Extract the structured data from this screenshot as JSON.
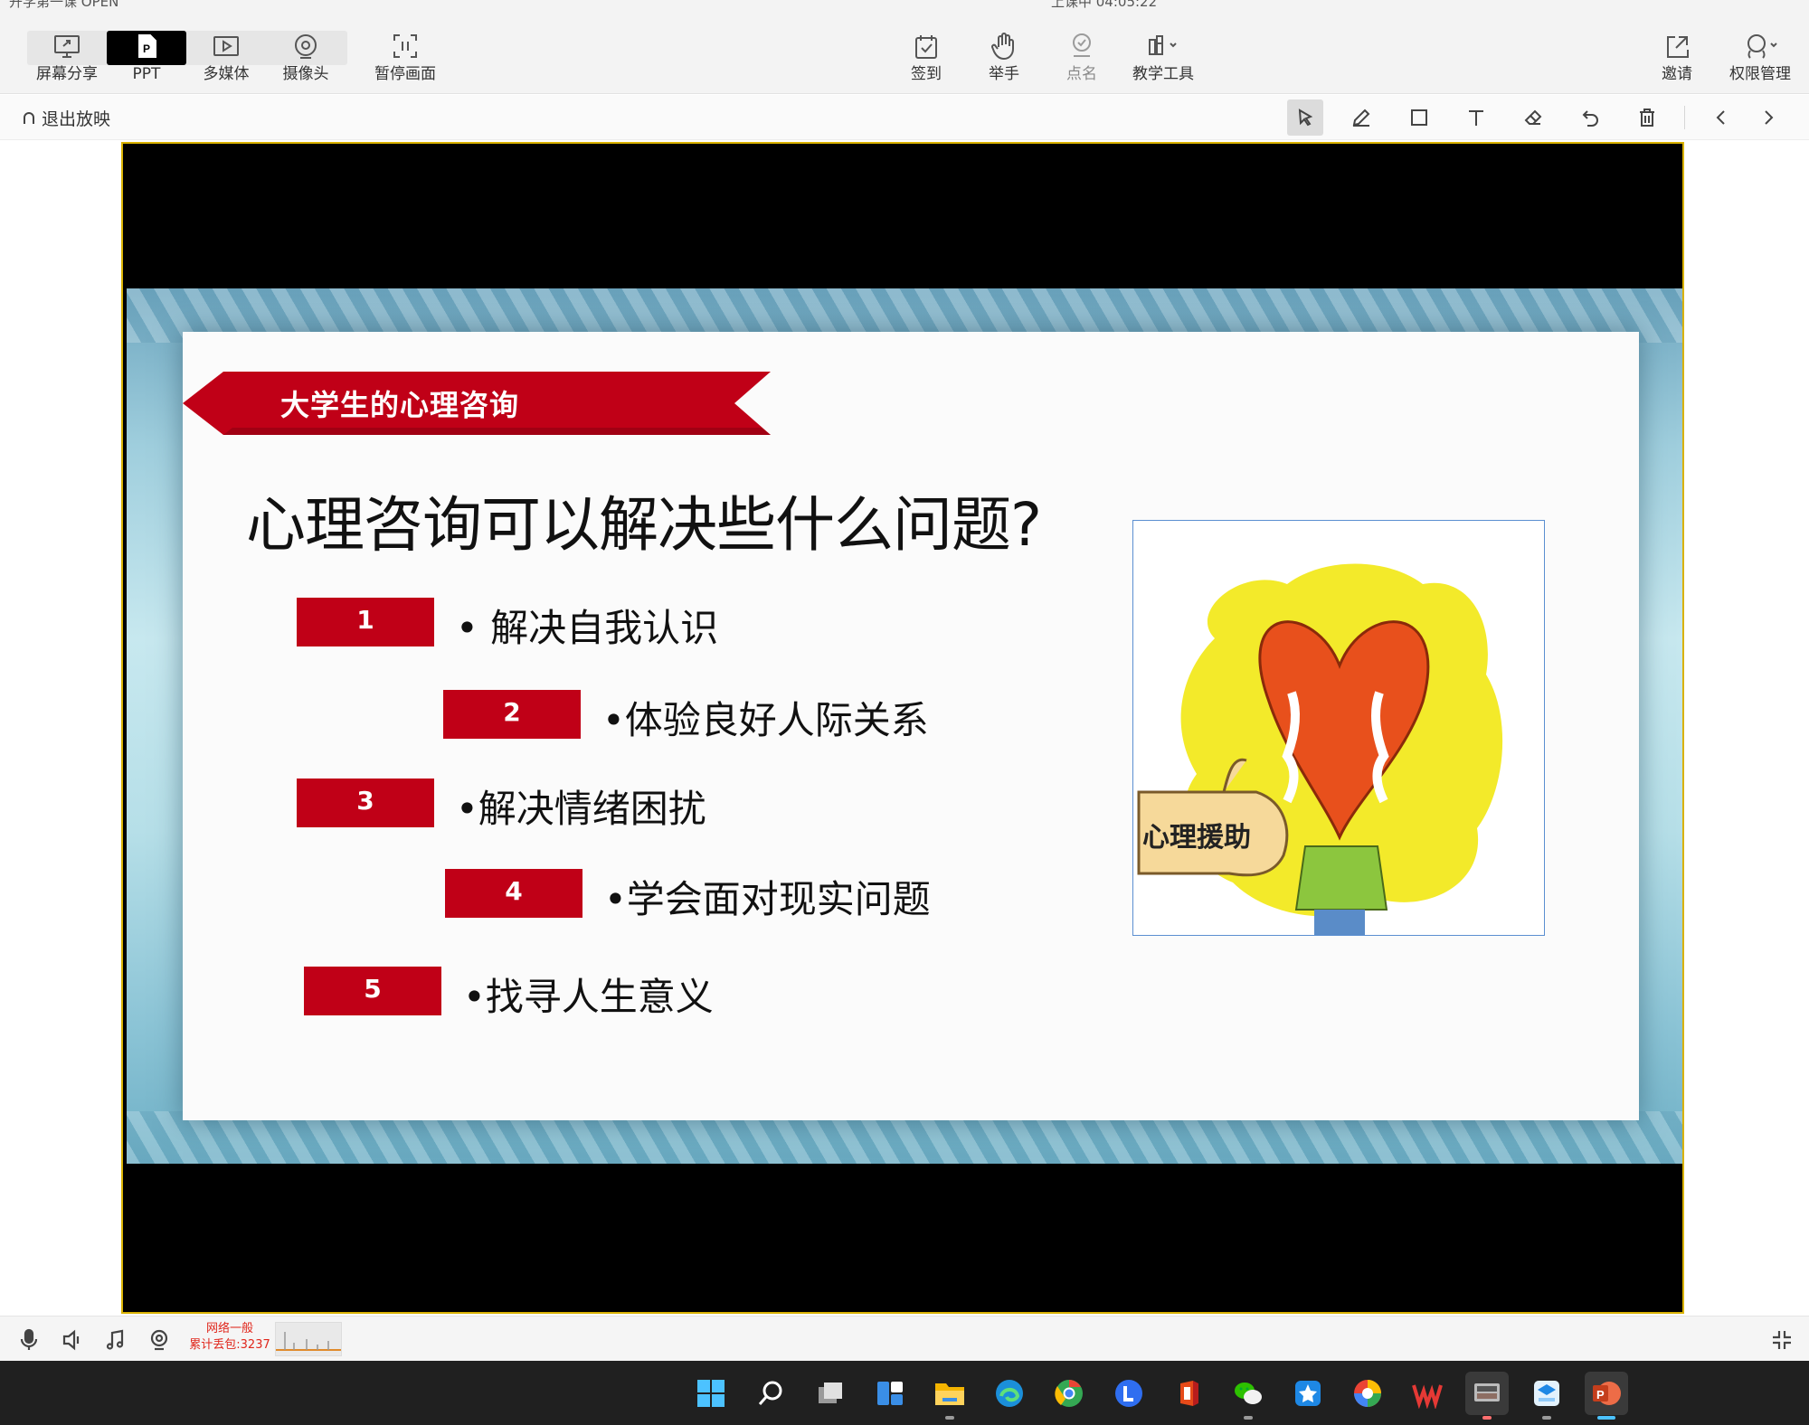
{
  "window": {
    "title_left": "开学第一课 OPEN",
    "title_center": "上课中 04:05:22"
  },
  "toolbar": {
    "left": [
      {
        "label": "屏幕分享",
        "icon": "screen-share-icon"
      },
      {
        "label": "PPT",
        "icon": "ppt-icon"
      },
      {
        "label": "多媒体",
        "icon": "media-play-icon"
      },
      {
        "label": "摄像头",
        "icon": "camera-icon"
      },
      {
        "label": "暂停画面",
        "icon": "pause-frame-icon"
      }
    ],
    "center": [
      {
        "label": "签到",
        "icon": "checkin-icon"
      },
      {
        "label": "举手",
        "icon": "raise-hand-icon"
      },
      {
        "label": "点名",
        "icon": "roll-call-icon"
      },
      {
        "label": "教学工具",
        "icon": "teaching-tools-icon"
      }
    ],
    "right": [
      {
        "label": "邀请",
        "icon": "invite-share-icon"
      },
      {
        "label": "权限管理",
        "icon": "permission-icon"
      }
    ],
    "active": "PPT"
  },
  "subbar": {
    "exit_label": "退出放映",
    "tools": [
      "select-arrow-icon",
      "pen-icon",
      "rectangle-icon",
      "text-icon",
      "eraser-icon",
      "undo-icon",
      "trash-icon"
    ],
    "nav": [
      "prev-page-icon",
      "next-page-icon"
    ],
    "selected_tool": "select-arrow-icon"
  },
  "slide": {
    "ribbon": "大学生的心理咨询",
    "title": "心理咨询可以解决些什么问题?",
    "items": [
      {
        "num": "1",
        "text": "• 解决自我认识"
      },
      {
        "num": "2",
        "text": "•体验良好人际关系"
      },
      {
        "num": "3",
        "text": "•解决情绪困扰"
      },
      {
        "num": "4",
        "text": "•学会面对现实问题"
      },
      {
        "num": "5",
        "text": "•找寻人生意义"
      }
    ],
    "illustration_text": "心理援助",
    "accent_color": "#c00017"
  },
  "status": {
    "net_quality": "网络一般",
    "packet_loss": "累计丢包:3237"
  },
  "taskbar": {
    "apps": [
      "windows-start-icon",
      "search-icon",
      "task-view-icon",
      "widgets-icon",
      "file-explorer-icon",
      "edge-icon",
      "chrome-icon",
      "lark-icon",
      "office-icon",
      "wechat-icon",
      "assistant-icon",
      "colorful-app-icon",
      "wps-icon",
      "classroom-app-icon",
      "cloud-app-icon",
      "powerpoint-icon"
    ]
  }
}
